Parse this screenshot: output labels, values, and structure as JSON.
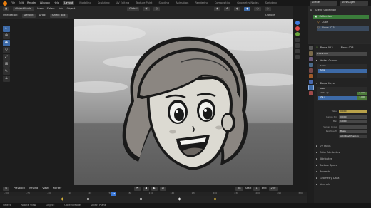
{
  "topbar": {
    "menus": [
      "File",
      "Edit",
      "Render",
      "Window",
      "Help"
    ],
    "workspaces": [
      "Layout",
      "Modeling",
      "Sculpting",
      "UV Editing",
      "Texture Paint",
      "Shading",
      "Animation",
      "Rendering",
      "Compositing",
      "Geometry Nodes",
      "Scripting"
    ],
    "active_workspace": "Layout",
    "scene": "Scene",
    "view_layer": "ViewLayer"
  },
  "viewport_header": {
    "mode": "Object Mode",
    "menus": [
      "View",
      "Select",
      "Add",
      "Object"
    ],
    "orientation_label": "Orientation:",
    "orientation": "Default",
    "drag_label": "Drag:",
    "drag": "Select Box",
    "transform_orientation": "Global",
    "options": "Options"
  },
  "outliner": {
    "title": "Scene Collection",
    "items": [
      "Collection",
      "Cube",
      "Plane.023"
    ]
  },
  "properties": {
    "object_name": "Plane.023",
    "data_name": "Plane.023",
    "sections": {
      "vertex_groups": "Vertex Groups",
      "shape_keys": "Shape Keys",
      "uv_maps": "UV Maps",
      "color_attributes": "Color Attributes",
      "attributes": "Attributes",
      "texture_space": "Texture Space",
      "remesh": "Remesh",
      "geometry_data": "Geometry Data",
      "normals": "Normals"
    },
    "vertex_groups_list": [
      "Name",
      "Tullia"
    ],
    "shape_keys_list": [
      {
        "name": "Basis",
        "value": ""
      },
      {
        "name": "smile up",
        "value": "0.000"
      },
      {
        "name": "sha 2",
        "value": "1.000"
      }
    ],
    "shape_fields": {
      "value_label": "Value",
      "value": "0.000",
      "range_min_label": "Range Min",
      "range_min": "0.000",
      "max_label": "Max",
      "max": "1.000",
      "vertex_group_label": "Vertex Group",
      "relative_to_label": "Relative To",
      "relative_to": "Basis",
      "add_rest": "Add Rest Position"
    }
  },
  "timeline": {
    "menus": [
      "Playback",
      "Keying",
      "View",
      "Marker"
    ],
    "current_frame": "58",
    "start_label": "Start",
    "start": "1",
    "end_label": "End",
    "end": "250",
    "ruler": [
      "-100",
      "-70",
      "-40",
      "-10",
      "20",
      "50",
      "80",
      "110",
      "140",
      "170",
      "200",
      "230",
      "260",
      "290",
      "320"
    ]
  },
  "status": {
    "items": [
      "Select",
      "Rotate View",
      "Object",
      "Object Mode",
      "Select Plane"
    ]
  },
  "colors": {
    "accent_blue": "#3d6aa7",
    "playhead": "#3a78d8",
    "collection_green": "#3b7d3b",
    "keyframe_yellow": "#d6b13a"
  }
}
